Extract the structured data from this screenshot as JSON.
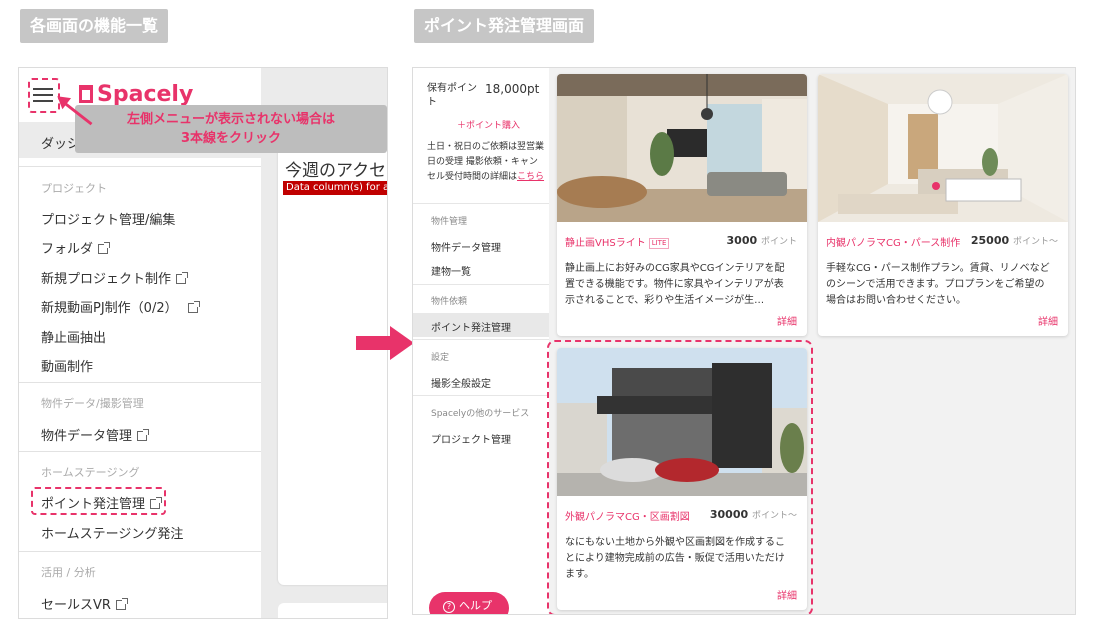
{
  "headers": {
    "left": "各画面の機能一覧",
    "right": "ポイント発注管理画面"
  },
  "left_panel": {
    "logo_text": "Spacely",
    "callout_line1": "左側メニューが表示されない場合は",
    "callout_line2": "3本線をクリック",
    "dashboard_label": "ダッシュス",
    "weekly_title": "今週のアクセ",
    "error_text": "Data column(s) for a",
    "sections": [
      {
        "head": "プロジェクト",
        "items": [
          "プロジェクト管理/編集",
          "フォルダ",
          "新規プロジェクト制作",
          "新規動画PJ制作（0/2）",
          "静止画抽出",
          "動画制作"
        ]
      },
      {
        "head": "物件データ/撮影管理",
        "items": [
          "物件データ管理"
        ]
      },
      {
        "head": "ホームステージング",
        "items": [
          "ポイント発注管理",
          "ホームステージング発注"
        ]
      },
      {
        "head": "活用 / 分析",
        "items": [
          "セールスVR"
        ]
      }
    ]
  },
  "right_panel": {
    "points_label": "保有ポイント",
    "points_value": "18,000pt",
    "buy_label": "＋ポイント購入",
    "note_text": "土日・祝日のご依頼は翌営業日の受理 撮影依頼・キャンセル受付時間の詳細は",
    "note_link": "こちら",
    "nav": [
      {
        "head": "物件管理",
        "items": [
          "物件データ管理",
          "建物一覧"
        ]
      },
      {
        "head": "物件依頼",
        "items": [
          "ポイント発注管理"
        ]
      },
      {
        "head": "設定",
        "items": [
          "撮影全般設定"
        ]
      },
      {
        "head": "Spacelyの他のサービス",
        "items": [
          "プロジェクト管理"
        ]
      }
    ],
    "help_label": "ヘルプ",
    "cards": [
      {
        "title": "静止画VHSライト",
        "badge": "LITE",
        "points": "3000",
        "points_unit": "ポイント",
        "desc": "静止画上にお好みのCG家具やCGインテリアを配置できる機能です。物件に家具やインテリアが表示されることで、彩りや生活イメージが生…",
        "detail": "詳細"
      },
      {
        "title": "内観パノラマCG・パース制作",
        "badge": "",
        "points": "25000",
        "points_unit": "ポイント〜",
        "desc": "手軽なCG・パース制作プラン。賃貸、リノベなどのシーンで活用できます。プロプランをご希望の場合はお問い合わせください。",
        "detail": "詳細"
      },
      {
        "title": "外観パノラマCG・区画割図",
        "badge": "",
        "points": "30000",
        "points_unit": "ポイント〜",
        "desc": "なにもない土地から外観や区画割図を作成することにより建物完成前の広告・販促で活用いただけます。",
        "detail": "詳細"
      }
    ]
  },
  "colors": {
    "accent": "#e8336a",
    "header_bg": "#c6c6c6",
    "error_bg": "#c00000"
  }
}
